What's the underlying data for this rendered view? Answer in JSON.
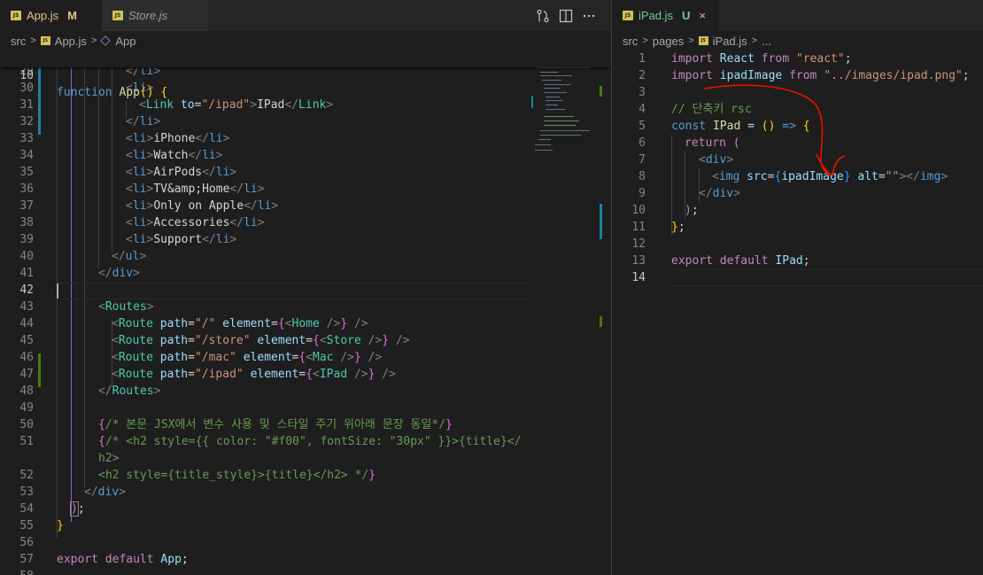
{
  "left": {
    "tabs": [
      {
        "name": "App.js",
        "status": "M",
        "active": true
      },
      {
        "name": "Store.js",
        "active": false
      }
    ],
    "breadcrumb": [
      "src",
      "App.js",
      "App"
    ],
    "sticky": {
      "num": "10",
      "code": "function App() {"
    },
    "lines": [
      {
        "num": "29",
        "code": "</li>"
      },
      {
        "num": "30",
        "code": "<li>"
      },
      {
        "num": "31",
        "code": "<Link to=\"/ipad\">IPad</Link>"
      },
      {
        "num": "32",
        "code": "</li>"
      },
      {
        "num": "33",
        "code": "<li>iPhone</li>"
      },
      {
        "num": "34",
        "code": "<li>Watch</li>"
      },
      {
        "num": "35",
        "code": "<li>AirPods</li>"
      },
      {
        "num": "36",
        "code": "<li>TV&amp;Home</li>"
      },
      {
        "num": "37",
        "code": "<li>Only on Apple</li>"
      },
      {
        "num": "38",
        "code": "<li>Accessories</li>"
      },
      {
        "num": "39",
        "code": "<li>Support</li>"
      },
      {
        "num": "40",
        "code": "</ul>"
      },
      {
        "num": "41",
        "code": "</div>"
      },
      {
        "num": "42",
        "code": ""
      },
      {
        "num": "43",
        "code": "<Routes>"
      },
      {
        "num": "44",
        "code": "<Route path=\"/\" element={<Home />} />"
      },
      {
        "num": "45",
        "code": "<Route path=\"/store\" element={<Store />} />"
      },
      {
        "num": "46",
        "code": "<Route path=\"/mac\" element={<Mac />} />"
      },
      {
        "num": "47",
        "code": "<Route path=\"/ipad\" element={<IPad />} />"
      },
      {
        "num": "48",
        "code": "</Routes>"
      },
      {
        "num": "49",
        "code": ""
      },
      {
        "num": "50",
        "code": "{/* 본문 JSX에서 변수 사용 및 스타일 주기 위아래 문장 동일*/}"
      },
      {
        "num": "51",
        "code": "{/* <h2 style={{ color: \"#f00\", fontSize: \"30px\" }}>{title}</"
      },
      {
        "num": "",
        "code": "h2>"
      },
      {
        "num": "52",
        "code": "<h2 style={title_style}>{title}</h2> */}"
      },
      {
        "num": "53",
        "code": "</div>"
      },
      {
        "num": "54",
        "code": ");"
      },
      {
        "num": "55",
        "code": "}"
      },
      {
        "num": "56",
        "code": ""
      },
      {
        "num": "57",
        "code": "export default App;"
      },
      {
        "num": "58",
        "code": ""
      }
    ]
  },
  "right": {
    "tab": {
      "name": "iPad.js",
      "status": "U",
      "close": "×"
    },
    "breadcrumb": [
      "src",
      "pages",
      "iPad.js",
      "..."
    ],
    "lines": [
      {
        "num": "1",
        "code": "import React from \"react\";"
      },
      {
        "num": "2",
        "code": "import ipadImage from \"../images/ipad.png\";"
      },
      {
        "num": "3",
        "code": ""
      },
      {
        "num": "4",
        "code": "// 단축키 rsc"
      },
      {
        "num": "5",
        "code": "const IPad = () => {"
      },
      {
        "num": "6",
        "code": "return ("
      },
      {
        "num": "7",
        "code": "<div>"
      },
      {
        "num": "8",
        "code": "<img src={ipadImage} alt=\"\"></img>"
      },
      {
        "num": "9",
        "code": "</div>"
      },
      {
        "num": "10",
        "code": ");"
      },
      {
        "num": "11",
        "code": "};"
      },
      {
        "num": "12",
        "code": ""
      },
      {
        "num": "13",
        "code": "export default IPad;"
      },
      {
        "num": "14",
        "code": ""
      }
    ]
  },
  "icons": [
    "source-control-icon",
    "split-editor-icon",
    "more-icon"
  ],
  "colors": {
    "bg": "#1e1e1e",
    "tabbar": "#252526",
    "modified": "#e2c08d",
    "untracked": "#73c991",
    "annotation": "#e51400"
  }
}
